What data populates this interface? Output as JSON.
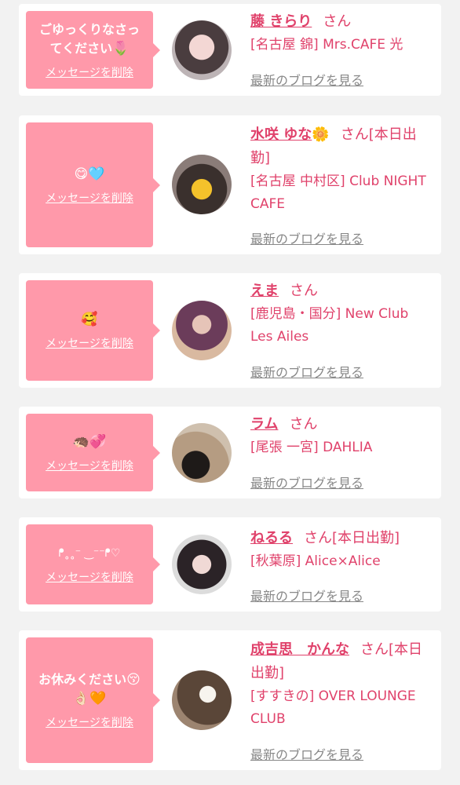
{
  "delete_label": "メッセージを削除",
  "san_label": "さん",
  "blog_label": "最新のブログを見る",
  "colors": {
    "bubble": "#ff99aa",
    "name": "#e0426b",
    "blog": "#888888",
    "background": "#f2f2f2"
  },
  "entries": [
    {
      "message_text": "ごゆっくりなさってください",
      "message_emoji": "🌷",
      "name": "藤 きらり",
      "status": "",
      "shop": "[名古屋 錦] Mrs.CAFE 光"
    },
    {
      "message_text": "",
      "message_emoji": "😋🩵",
      "name": "水咲 ゆな",
      "name_emoji": "🌼",
      "status": "[本日出勤]",
      "shop": "[名古屋 中村区] Club NIGHT CAFE"
    },
    {
      "message_text": "",
      "message_emoji": "🥰",
      "name": "えま",
      "status": "",
      "shop": "[鹿児島・国分] New Club Les Ailes"
    },
    {
      "message_text": "",
      "message_emoji": "🦔💞",
      "name": "ラム",
      "status": "",
      "shop": "[尾張 一宮] DAHLIA"
    },
    {
      "message_text": "ᖰ˳˳⁻ ‿⁻⁻ᖰ♡",
      "message_emoji": "",
      "name": "ねるる",
      "status": "[本日出勤]",
      "shop": "[秋葉原] Alice×Alice"
    },
    {
      "message_text": "お休みください",
      "message_emoji": "😚👌🏻🧡",
      "name": "成吉思　かんな",
      "status": "[本日出勤]",
      "shop": "[すすきの] OVER LOUNGE CLUB"
    }
  ]
}
